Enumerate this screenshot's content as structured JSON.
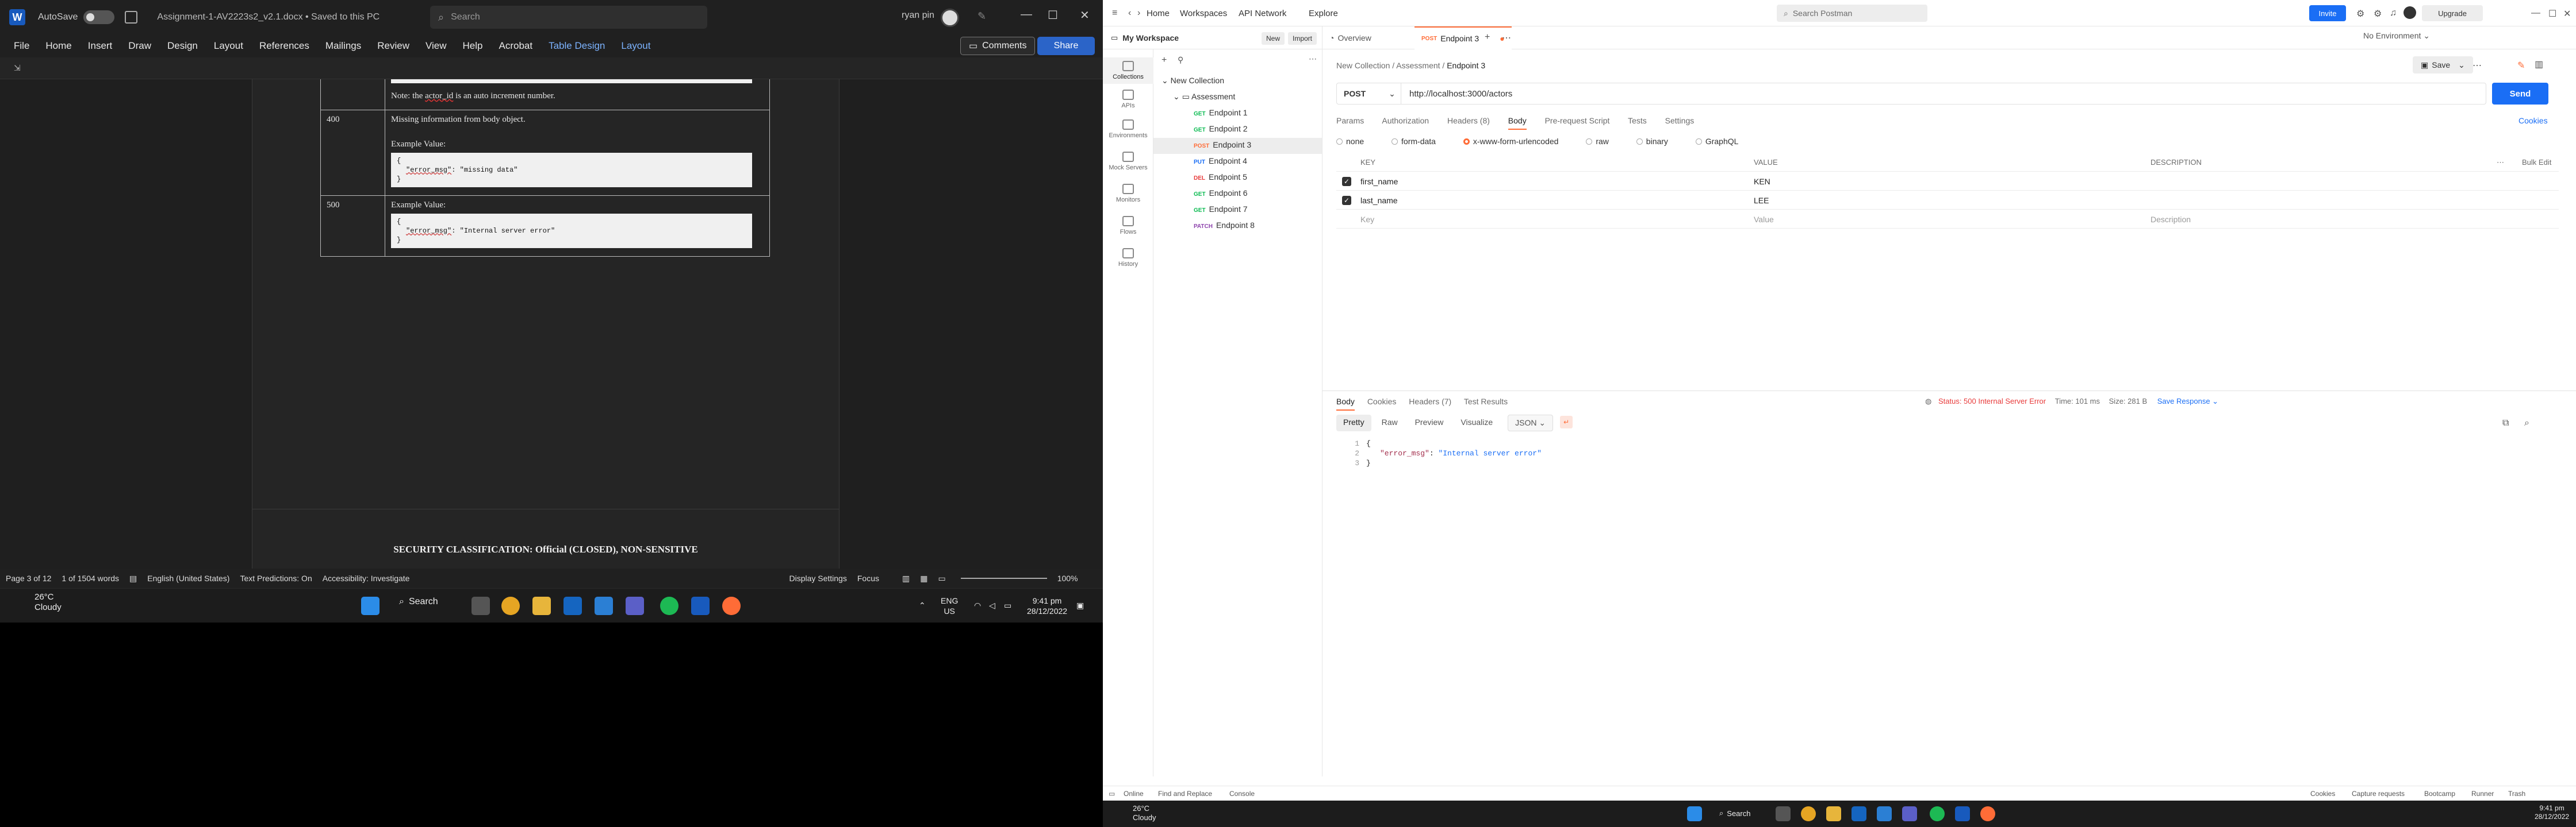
{
  "word": {
    "autosave_label": "AutoSave",
    "autosave_state": "Off",
    "doc_name": "Assignment-1-AV2223s2_v2.1.docx • Saved to this PC",
    "search_placeholder": "Search",
    "user_name": "ryan pin",
    "tabs": [
      "File",
      "Home",
      "Insert",
      "Draw",
      "Design",
      "Layout",
      "References",
      "Mailings",
      "Review",
      "View",
      "Help",
      "Acrobat",
      "Table Design",
      "Layout"
    ],
    "comments_label": "Comments",
    "share_label": "Share",
    "doc": {
      "note_prefix": "Note: the ",
      "note_field": "actor_id",
      "note_suffix": " is an auto increment number.",
      "rows": [
        {
          "code": "400",
          "desc": "Missing information from body object.",
          "example_label": "Example Value:",
          "json_open": "{",
          "json_key": "\"error_msg\"",
          "json_val": ": \"missing data\"",
          "json_close": "}"
        },
        {
          "code": "500",
          "desc": "",
          "example_label": "Example Value:",
          "json_open": "{",
          "json_key": "\"error_msg\"",
          "json_val": ": \"Internal server error\"",
          "json_close": "}"
        }
      ],
      "classification": "SECURITY CLASSIFICATION: Official (CLOSED), NON-SENSITIVE"
    },
    "status": {
      "page": "Page 3 of 12",
      "words": "1 of 1504 words",
      "language": "English (United States)",
      "predictions": "Text Predictions: On",
      "accessibility": "Accessibility: Investigate",
      "display": "Display Settings",
      "focus": "Focus",
      "zoom": "100%"
    }
  },
  "taskbar_left": {
    "temp": "26°C",
    "condition": "Cloudy",
    "search_label": "Search",
    "lang": "ENG",
    "region": "US",
    "time": "9:41 pm",
    "date": "28/12/2022"
  },
  "postman": {
    "nav": [
      "Home",
      "Workspaces",
      "API Network",
      "Explore"
    ],
    "search_placeholder": "Search Postman",
    "invite_label": "Invite",
    "upgrade_label": "Upgrade",
    "workspace": "My Workspace",
    "new_label": "New",
    "import_label": "Import",
    "rail": [
      "Collections",
      "APIs",
      "Environments",
      "Mock Servers",
      "Monitors",
      "Flows",
      "History"
    ],
    "collection": "New Collection",
    "folder": "Assessment",
    "requests": [
      {
        "method": "GET",
        "name": "Endpoint 1"
      },
      {
        "method": "GET",
        "name": "Endpoint 2"
      },
      {
        "method": "POST",
        "name": "Endpoint 3"
      },
      {
        "method": "PUT",
        "name": "Endpoint 4"
      },
      {
        "method": "DEL",
        "name": "Endpoint 5"
      },
      {
        "method": "GET",
        "name": "Endpoint 6"
      },
      {
        "method": "GET",
        "name": "Endpoint 7"
      },
      {
        "method": "PATCH",
        "name": "Endpoint 8"
      }
    ],
    "tabs": {
      "overview": "Overview",
      "active": "Endpoint 3",
      "active_method": "POST"
    },
    "environment": "No Environment",
    "breadcrumb": {
      "a": "New Collection",
      "b": "Assessment",
      "c": "Endpoint 3"
    },
    "save_label": "Save",
    "method": "POST",
    "url": "http://localhost:3000/actors",
    "send_label": "Send",
    "req_tabs": [
      "Params",
      "Authorization",
      "Headers (8)",
      "Body",
      "Pre-request Script",
      "Tests",
      "Settings"
    ],
    "cookies_label": "Cookies",
    "body_types": [
      "none",
      "form-data",
      "x-www-form-urlencoded",
      "raw",
      "binary",
      "GraphQL"
    ],
    "kv_headers": {
      "key": "KEY",
      "value": "VALUE",
      "description": "DESCRIPTION",
      "bulk": "Bulk Edit"
    },
    "kv_rows": [
      {
        "key": "first_name",
        "value": "KEN"
      },
      {
        "key": "last_name",
        "value": "LEE"
      }
    ],
    "kv_placeholder": {
      "key": "Key",
      "value": "Value",
      "description": "Description"
    },
    "resp_tabs": [
      "Body",
      "Cookies",
      "Headers (7)",
      "Test Results"
    ],
    "resp_status": "Status: 500 Internal Server Error",
    "resp_time": "Time: 101 ms",
    "resp_size": "Size: 281 B",
    "save_response": "Save Response",
    "formats": [
      "Pretty",
      "Raw",
      "Preview",
      "Visualize"
    ],
    "format_select": "JSON",
    "response_lines": [
      {
        "n": "1",
        "text": "{"
      },
      {
        "n": "2",
        "key": "\"error_msg\"",
        "val": "\"Internal server error\""
      },
      {
        "n": "3",
        "text": "}"
      }
    ],
    "status_bar": [
      "Online",
      "Find and Replace",
      "Console",
      "Cookies",
      "Capture requests",
      "Bootcamp",
      "Runner",
      "Trash"
    ]
  },
  "taskbar_right": {
    "temp": "26°C",
    "condition": "Cloudy",
    "search_label": "Search",
    "time": "9:41 pm",
    "date": "28/12/2022"
  }
}
